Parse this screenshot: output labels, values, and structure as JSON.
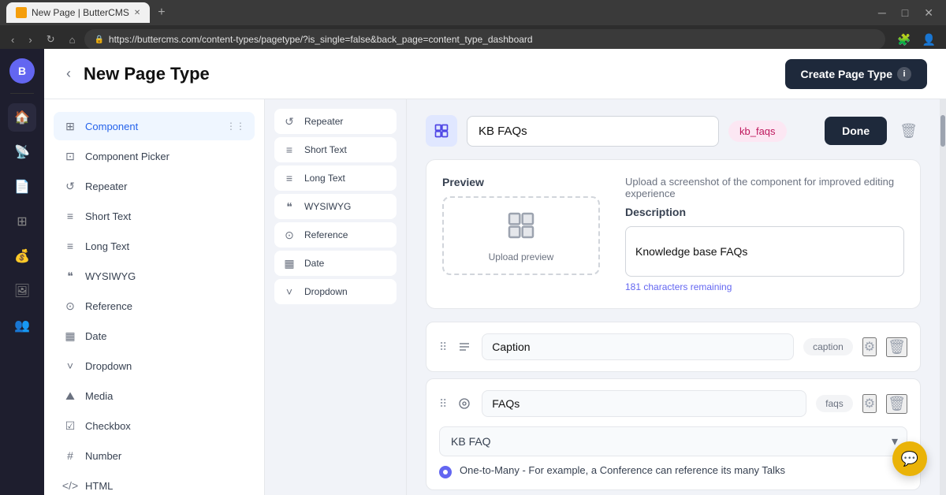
{
  "browser": {
    "tab_title": "New Page | ButterCMS",
    "url": "https://buttercms.com/content-types/pagetype/?is_single=false&back_page=content_type_dashboard",
    "favicon": "🧈"
  },
  "header": {
    "back_icon": "‹",
    "title": "New Page Type",
    "create_button": "Create Page Type",
    "info_icon": "i"
  },
  "field_sidebar": {
    "items": [
      {
        "id": "component",
        "label": "Component",
        "icon": "⊞",
        "has_drag": true
      },
      {
        "id": "component-picker",
        "label": "Component Picker",
        "icon": "⊡"
      },
      {
        "id": "repeater",
        "label": "Repeater",
        "icon": "↺"
      },
      {
        "id": "short-text",
        "label": "Short Text",
        "icon": "≡"
      },
      {
        "id": "long-text",
        "label": "Long Text",
        "icon": "≡"
      },
      {
        "id": "wysiwyg",
        "label": "WYSIWYG",
        "icon": "❝"
      },
      {
        "id": "reference",
        "label": "Reference",
        "icon": "⊙"
      },
      {
        "id": "date",
        "label": "Date",
        "icon": "▦"
      },
      {
        "id": "dropdown",
        "label": "Dropdown",
        "icon": "˅"
      },
      {
        "id": "media",
        "label": "Media",
        "icon": "⛰"
      },
      {
        "id": "checkbox",
        "label": "Checkbox",
        "icon": "☑"
      },
      {
        "id": "number",
        "label": "Number",
        "icon": "⊞"
      },
      {
        "id": "html",
        "label": "HTML",
        "icon": "⊟"
      }
    ]
  },
  "component": {
    "name": "KB FAQs",
    "slug": "kb_faqs",
    "done_button": "Done",
    "preview_label": "Preview",
    "upload_text": "Upload preview",
    "upload_note": "Upload a screenshot of the component for improved editing experience",
    "description_label": "Description",
    "description_value": "Knowledge base FAQs",
    "chars_remaining": "181 characters remaining"
  },
  "inner_sidebar": {
    "items": [
      {
        "id": "repeater",
        "label": "Repeater",
        "icon": "↺"
      },
      {
        "id": "short-text",
        "label": "Short Text",
        "icon": "≡"
      },
      {
        "id": "long-text",
        "label": "Long Text",
        "icon": "≡"
      },
      {
        "id": "wysiwyg",
        "label": "WYSIWYG",
        "icon": "❝"
      },
      {
        "id": "reference",
        "label": "Reference",
        "icon": "⊙"
      },
      {
        "id": "date",
        "label": "Date",
        "icon": "▦"
      },
      {
        "id": "dropdown",
        "label": "Dropdown",
        "icon": "˅"
      }
    ]
  },
  "fields": [
    {
      "id": "caption",
      "icon": "≡",
      "name": "Caption",
      "slug": "caption",
      "type": "short-text"
    },
    {
      "id": "faqs",
      "icon": "⊙",
      "name": "FAQs",
      "slug": "faqs",
      "type": "reference",
      "reference_target": "KB FAQ",
      "relationship": "One-to-Many - For example, a Conference can reference its many Talks"
    }
  ],
  "app_sidebar": {
    "icons": [
      "🏠",
      "📡",
      "📄",
      "⊞",
      "💰",
      "🖼",
      "👥"
    ]
  },
  "chat": {
    "icon": "💬"
  }
}
